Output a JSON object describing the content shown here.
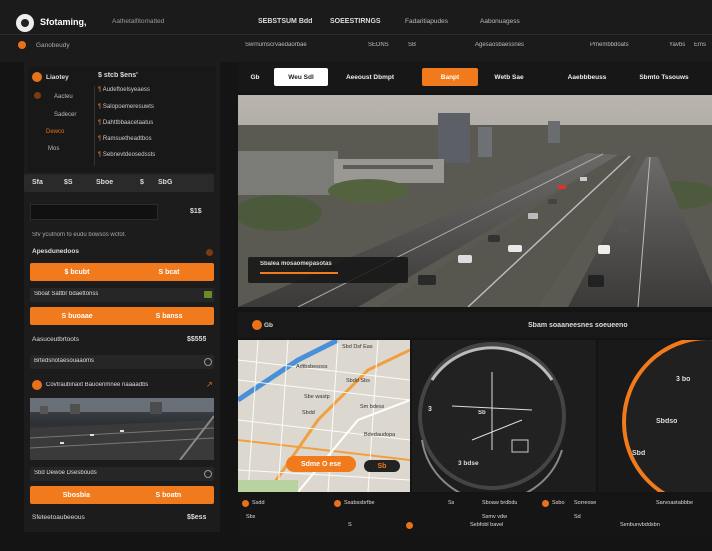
{
  "topbar": {
    "brand": "Sfotaming,",
    "brand_sub": "Aathetalfitomatted",
    "nav_left": "Ganobeudy",
    "nav_items": [
      "SEBSTSUM Bdd",
      "SOEESTIRNGS",
      "Fadaritiapudes",
      "Aabonuagess"
    ],
    "nav_row2": [
      "Swrnumscrvaedaorbae",
      "SEDNS",
      "SB",
      "Agesaosbaessnes",
      "Pmembbdoats",
      "Yavbs",
      "Ems"
    ]
  },
  "sidebar": {
    "header_label": "Liaotey",
    "header_value": "$ stcb $ens'",
    "nav": [
      "Aacteu",
      "Sadecer",
      "Dewco",
      "Mos"
    ],
    "list": [
      "Audeftoelsyeaess",
      "Salopoemeresuwts",
      "Dahttbbaacetaatus",
      "Ramsuetheadtbos",
      "Sebnevtdeosedssts"
    ],
    "stats": [
      "Sfa",
      "$S",
      "Sboe",
      "$",
      "SbG"
    ],
    "search_value": "$1$",
    "caption": "Sfv ycutnom fo eudu bowsos wcfot.",
    "group1_title": "Apesdunedoos",
    "group1_buttons": [
      "$ bcubt",
      "S bcat"
    ],
    "row_label": "Sboat Sattbr bdaettonss",
    "group2_buttons": [
      "S buoaae",
      "S banss"
    ],
    "row2_label": "Aasuceutbrtoots",
    "row2_value": "$$555",
    "row3_label": "Brtedsnotaesouaaoms",
    "alert_text": "Covtraubinaxt Bauoenmnee naaaadbs",
    "image_caption": "Sbd Dewoe Dsesbouds",
    "group3_buttons": [
      "Sbosbia",
      "S boatn"
    ],
    "footer_label": "Sfeteetoaubeeous",
    "footer_value": "$$ess"
  },
  "main": {
    "tabs": [
      "Gb",
      "Weu Sdl",
      "Aeeoust Dbmpt",
      "Banpt",
      "Wetb Sae",
      "Aaebbbeuss",
      "Sbmto Tssouws"
    ],
    "active_tab_index": 3,
    "overlay_caption": "Sbalea mosaomepasotas",
    "section_title": "Sbam soaaneesnes soeueeno",
    "section_icon_label": "Gb",
    "map_button": "Sdme O ese",
    "map_chip": "Sb",
    "map_labels": [
      "Sbd Dsf Eas",
      "Adtbsbesoss",
      "Sbdd Sbs",
      "Sbe wastp",
      "Sm bdess",
      "Sbdd",
      "Bdedaudopa"
    ],
    "gauge_labels": [
      "3",
      "Sb",
      "3 bdse"
    ],
    "gauge_right": [
      "3 bo",
      "Sbdso",
      "Sbd"
    ],
    "footer_row1": [
      "Ssdd",
      "Ssabssbrfbe",
      "Ss",
      "Sboaw brdbdu",
      "Ssbo",
      "Sorreose",
      "Sarvoastabbbe"
    ],
    "footer_row2": [
      "Sbs",
      "Ssmv vdw",
      "Sd",
      "S",
      "Sebfobl bavel",
      "Senbunvbddsbn"
    ]
  },
  "colors": {
    "accent": "#f07a1c",
    "bg": "#141414",
    "panel": "#202020"
  }
}
